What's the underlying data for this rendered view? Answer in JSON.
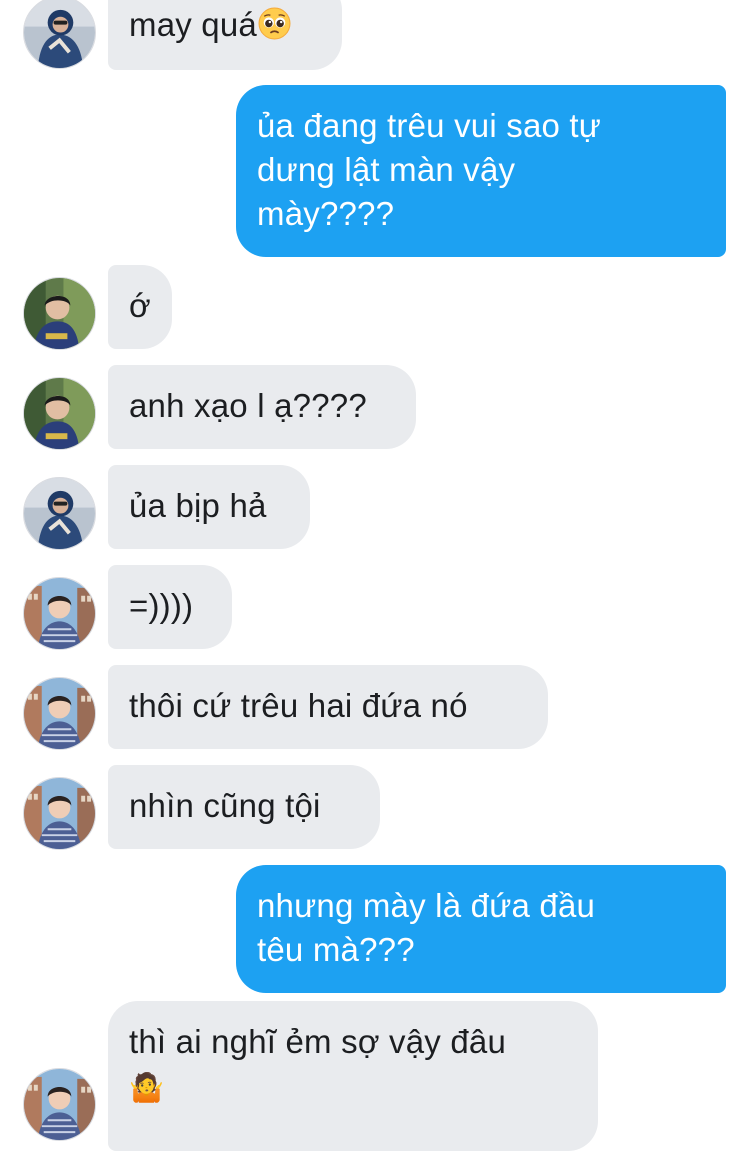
{
  "conversation": {
    "messages": [
      {
        "id": "m0",
        "side": "in",
        "text": "may quá",
        "emoji": "pleading-face"
      },
      {
        "id": "m1",
        "side": "out",
        "lines": [
          "ủa đang trêu vui sao tự",
          "dưng lật màn vậy",
          "mày????"
        ]
      },
      {
        "id": "m2",
        "side": "in",
        "text": "ớ"
      },
      {
        "id": "m3",
        "side": "in",
        "text": "anh xạo l ạ????"
      },
      {
        "id": "m4",
        "side": "in",
        "text": "ủa bịp hả"
      },
      {
        "id": "m5",
        "side": "in",
        "text": "=))))"
      },
      {
        "id": "m6",
        "side": "in",
        "text": "thôi cứ trêu hai đứa nó"
      },
      {
        "id": "m7",
        "side": "in",
        "text": "nhìn cũng tội"
      },
      {
        "id": "m8",
        "side": "out",
        "lines": [
          "nhưng mày là đứa đầu",
          "têu mà???"
        ]
      },
      {
        "id": "m9",
        "side": "in",
        "lines": [
          "thì ai nghĩ ẻm sợ vậy đâu"
        ],
        "emoji_glyph": "🤷"
      }
    ]
  },
  "colors": {
    "outgoing_bubble": "#1da1f2",
    "incoming_bubble": "#e9ebee",
    "incoming_text": "#1c1e21",
    "outgoing_text": "#ffffff"
  },
  "icons": {
    "m0_emoji": "pleading-face-icon",
    "m9_emoji": "person-shrugging-icon"
  }
}
